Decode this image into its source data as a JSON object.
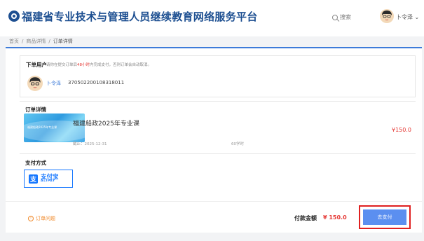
{
  "header": {
    "site_title": "福建省专业技术与管理人员继续教育网络服务平台",
    "search_label": "搜索",
    "user_name": "卜令泽 ⌄"
  },
  "breadcrumb": {
    "items": [
      "首页",
      "/",
      "商品详情",
      "/",
      "订单详情"
    ]
  },
  "buyer": {
    "section_title": "下单用户",
    "note_before": "请你在提交订单后",
    "note_highlight": "48小时",
    "note_after": "内完成支付，否则订单会自动取消。",
    "name": "卜令泽",
    "id_number": "370502200108318011"
  },
  "order": {
    "section_title": "订单详情",
    "thumb_text": "福建船政2025年专业课",
    "product_name": "福建船政2025年专业课",
    "deadline": "截止：2025-12-31",
    "hours": "60学时",
    "price": "¥150.0"
  },
  "payment": {
    "section_title": "支付方式",
    "alipay_cn": "支付宝",
    "alipay_en": "ALIPAY"
  },
  "footer": {
    "issue_label": "订单问题",
    "total_label": "付款金额",
    "total_value": "¥ 150.0",
    "pay_button": "去支付"
  },
  "colors": {
    "brand": "#1d4f91",
    "accent_blue": "#3d7bd9",
    "price_red": "#e53935",
    "warning_orange": "#f0892a",
    "pay_button": "#5b8ff0",
    "highlight_box": "#e02020"
  }
}
